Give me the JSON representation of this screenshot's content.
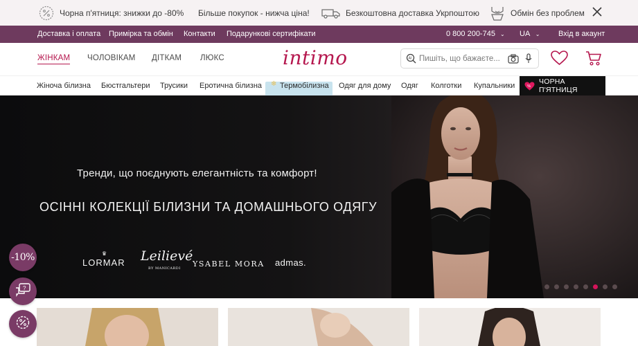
{
  "promo": {
    "items": [
      {
        "icon": "percent-badge-icon",
        "text": "Чорна п'ятниця: знижки до -80%"
      },
      {
        "icon": "",
        "text": "Більше покупок - нижча ціна!"
      },
      {
        "icon": "delivery-truck-icon",
        "text": "Безкоштовна доставка Укрпоштою"
      },
      {
        "icon": "exchange-lingerie-icon",
        "text": "Обмін без проблем"
      }
    ],
    "close_icon": "close-icon"
  },
  "utility": {
    "links": [
      "Доставка і оплата",
      "Примірка та обмін",
      "Контакти",
      "Подарункові сертифікати"
    ],
    "phone": "0 800 200-745",
    "language": "UA",
    "login": "Вхід в акаунт"
  },
  "header": {
    "tabs": [
      "ЖІНКАМ",
      "ЧОЛОВІКАМ",
      "ДІТКАМ",
      "ЛЮКС"
    ],
    "active_tab": 0,
    "logo": "intimo",
    "search_placeholder": "Пишіть, що бажаєте...",
    "icons": [
      "search-icon",
      "camera-icon",
      "microphone-icon",
      "heart-icon",
      "cart-icon"
    ]
  },
  "categories": {
    "items": [
      "Жіноча білизна",
      "Бюстгальтери",
      "Трусики",
      "Еротична білизна",
      "Термобілизна",
      "Одяг для дому",
      "Одяг",
      "Колготки",
      "Купальники"
    ],
    "black_friday": "ЧОРНА П'ЯТНИЦЯ"
  },
  "hero": {
    "subtitle": "Тренди, що поєднують елегантність та комфорт!",
    "title": "ОСІННІ КОЛЕКЦІЇ БІЛИЗНИ ТА ДОМАШНЬОГО ОДЯГУ",
    "brands": [
      "LORMAR",
      "Leilievé",
      "BY MANICARDI",
      "YSABEL MORA",
      "admas."
    ],
    "slides_total": 7,
    "active_slide": 5
  },
  "floating": {
    "discount": "-10%",
    "icons": [
      "chat-support-icon",
      "settings-badge-icon"
    ]
  },
  "colors": {
    "accent": "#b5174e",
    "utility_bar": "#6e3a5e",
    "float_button": "#7a3b66",
    "promo_bar": "#f6f2f3",
    "black_friday_bg": "#111111",
    "active_dot": "#d4145a"
  }
}
